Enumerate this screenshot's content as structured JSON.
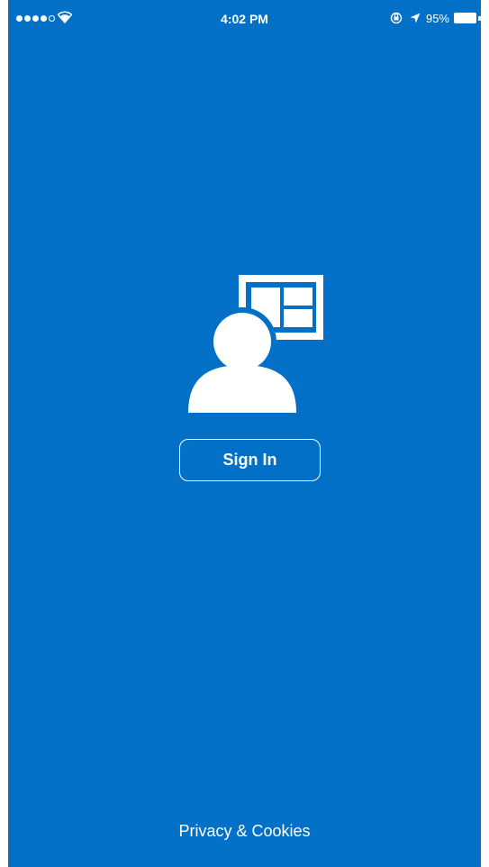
{
  "status_bar": {
    "time": "4:02 PM",
    "battery_percent": "95%",
    "signal_bars_filled": 4,
    "signal_bars_total": 5,
    "icons": [
      "signal-dots-icon",
      "wifi-icon",
      "rotation-lock-icon",
      "location-arrow-icon",
      "battery-icon"
    ]
  },
  "colors": {
    "background": "#0270c6",
    "foreground": "#ffffff"
  },
  "main": {
    "icon": "user-with-dashboard-icon",
    "sign_in_label": "Sign In"
  },
  "footer": {
    "privacy_label": "Privacy & Cookies"
  }
}
